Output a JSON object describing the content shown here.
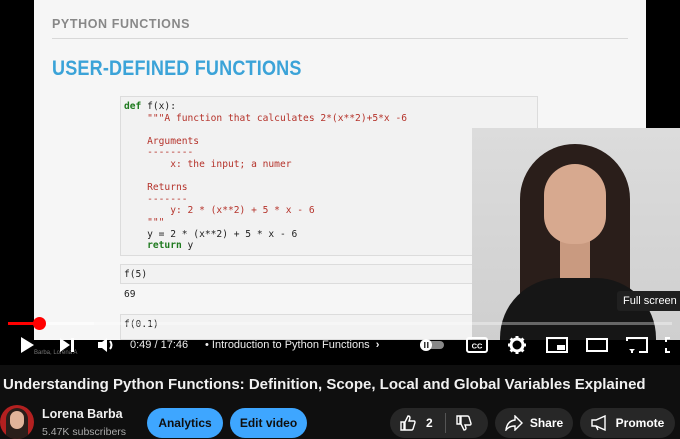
{
  "slide": {
    "header": "PYTHON FUNCTIONS",
    "title": "USER-DEFINED FUNCTIONS",
    "code": {
      "line1_kw": "def",
      "line1_rest": " f(x):",
      "line2": "    \"\"\"A function that calculates 2*(x**2)+5*x -6",
      "line3": "    Arguments",
      "line4": "    --------",
      "line5": "        x: the input; a numer",
      "line6": "    Returns",
      "line7": "    -------",
      "line8": "        y: 2 * (x**2) + 5 * x - 6",
      "line9": "    \"\"\"",
      "line10": "    y = 2 * (x**2) + 5 * x - 6",
      "line11_kw": "return",
      "line11_rest": " y"
    },
    "cell2_input": "f(5)",
    "cell2_output": "69",
    "cell3_input": "f(0.1)"
  },
  "watermark": "Barba, Lorena A",
  "tooltip": "Full screen",
  "player": {
    "progress_played": 0.047,
    "progress_buffered": 0.13,
    "time": "0:49 / 17:46",
    "chapter": "Introduction to Python Functions"
  },
  "video": {
    "title": "Understanding Python Functions: Definition, Scope, Local and Global Variables Explained"
  },
  "channel": {
    "name": "Lorena Barba",
    "subscribers": "5.47K subscribers"
  },
  "actions": {
    "analytics": "Analytics",
    "edit_video": "Edit video",
    "likes": "2",
    "share": "Share",
    "promote": "Promote"
  },
  "colors": {
    "accent_blue": "#3ea6ff",
    "progress_red": "#ff0000",
    "slide_title": "#3ba3d8"
  }
}
